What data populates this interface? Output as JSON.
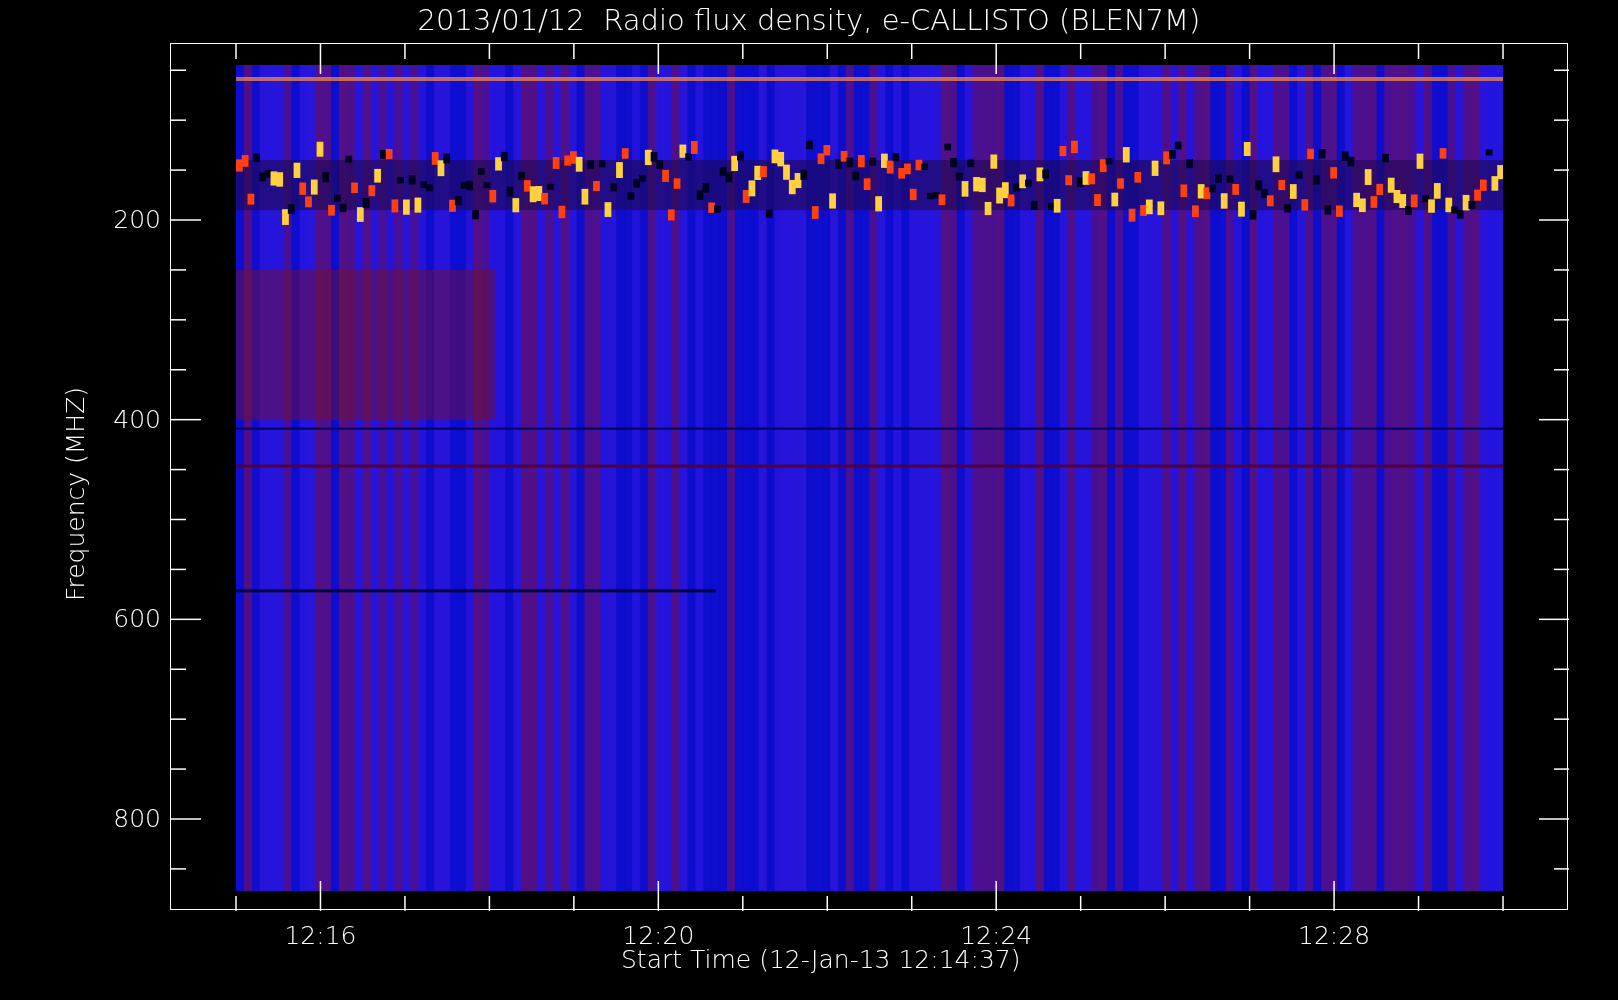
{
  "title": "2013/01/12  Radio flux density, e-CALLISTO (BLEN7M)",
  "y_axis": {
    "label": "Frequency (MHZ)",
    "ticks": [
      "200",
      "400",
      "600",
      "800"
    ]
  },
  "x_axis": {
    "label": "Start Time (12-Jan-13 12:14:37)",
    "ticks": [
      "12:16",
      "12:20",
      "12:24",
      "12:28"
    ]
  }
}
